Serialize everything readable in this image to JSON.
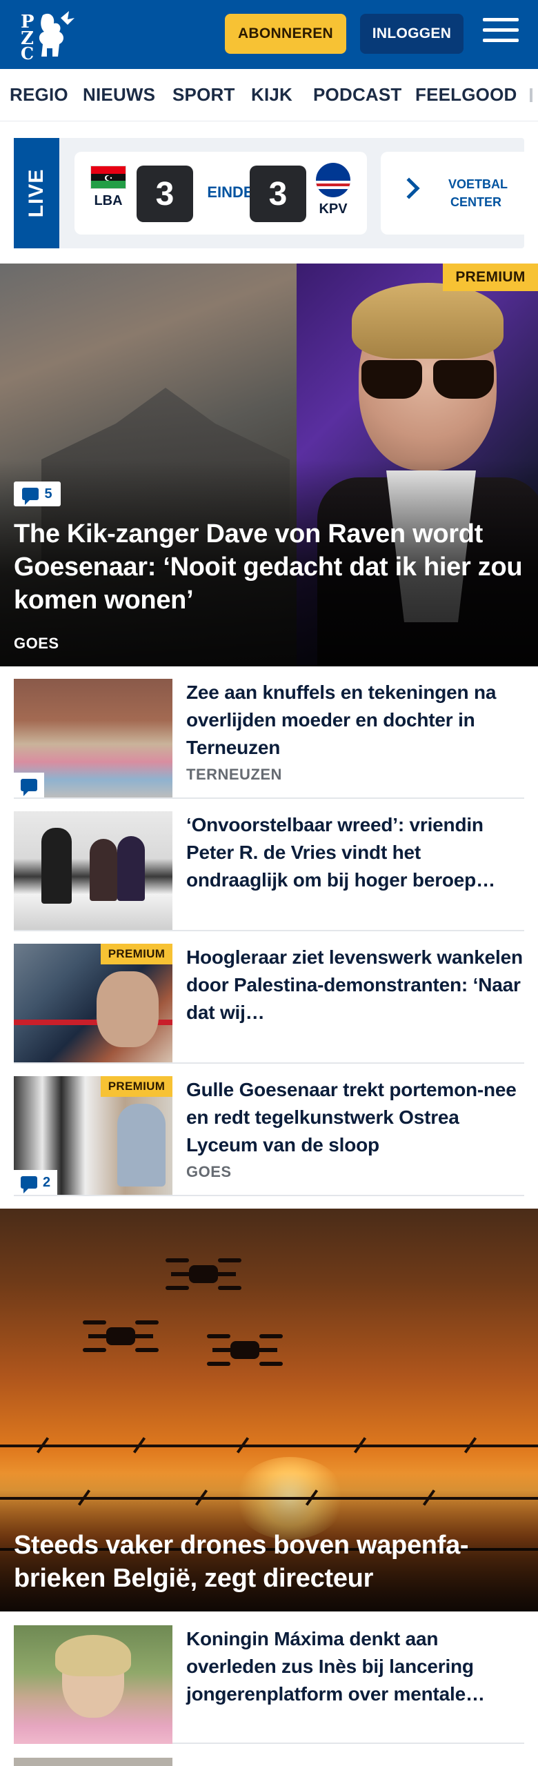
{
  "header": {
    "logo_text": "PZC",
    "subscribe_label": "ABONNEREN",
    "login_label": "INLOGGEN",
    "colors": {
      "brand": "#0053a0",
      "accent": "#f7c234"
    }
  },
  "nav": {
    "items": [
      "REGIO",
      "NIEUWS",
      "SPORT",
      "KIJK",
      "PODCAST",
      "FEELGOOD"
    ]
  },
  "live": {
    "tag": "LIVE",
    "match": {
      "home_code": "LBA",
      "home_score": "3",
      "status": "EINDE",
      "away_score": "3",
      "away_code": "KPV"
    },
    "voetbal_center": "VOETBAL CENTER"
  },
  "hero": {
    "premium": "PREMIUM",
    "comments": "5",
    "title": "The Kik-zanger Dave von Raven wordt Goesenaar: ‘Nooit gedacht dat ik hier zou komen wonen’",
    "location": "GOES"
  },
  "articles": [
    {
      "title": "Zee aan knuffels en tekeningen na overlijden moeder en dochter in Terneuzen",
      "location": "TERNEUZEN",
      "premium": "",
      "comments": ""
    },
    {
      "title": "‘Onvoorstelbaar wreed’: vriendin Peter R. de Vries vindt het ondraaglijk om bij hoger beroep…",
      "location": "",
      "premium": "",
      "comments": ""
    },
    {
      "title": "Hoogleraar ziet levenswerk wankelen door Palestina-demonstranten: ‘Naar dat wij…",
      "location": "",
      "premium": "PREMIUM",
      "comments": ""
    },
    {
      "title": "Gulle Goesenaar trekt portemon-nee en redt tegelkunstwerk Ostrea Lyceum van de sloop",
      "location": "GOES",
      "premium": "PREMIUM",
      "comments": "2"
    }
  ],
  "big_article": {
    "title": "Steeds vaker drones boven wapenfa-brieken België, zegt directeur"
  },
  "article_after": {
    "title": "Koningin Máxima denkt aan overleden zus Inès bij lancering jongerenplatform over mentale…"
  }
}
